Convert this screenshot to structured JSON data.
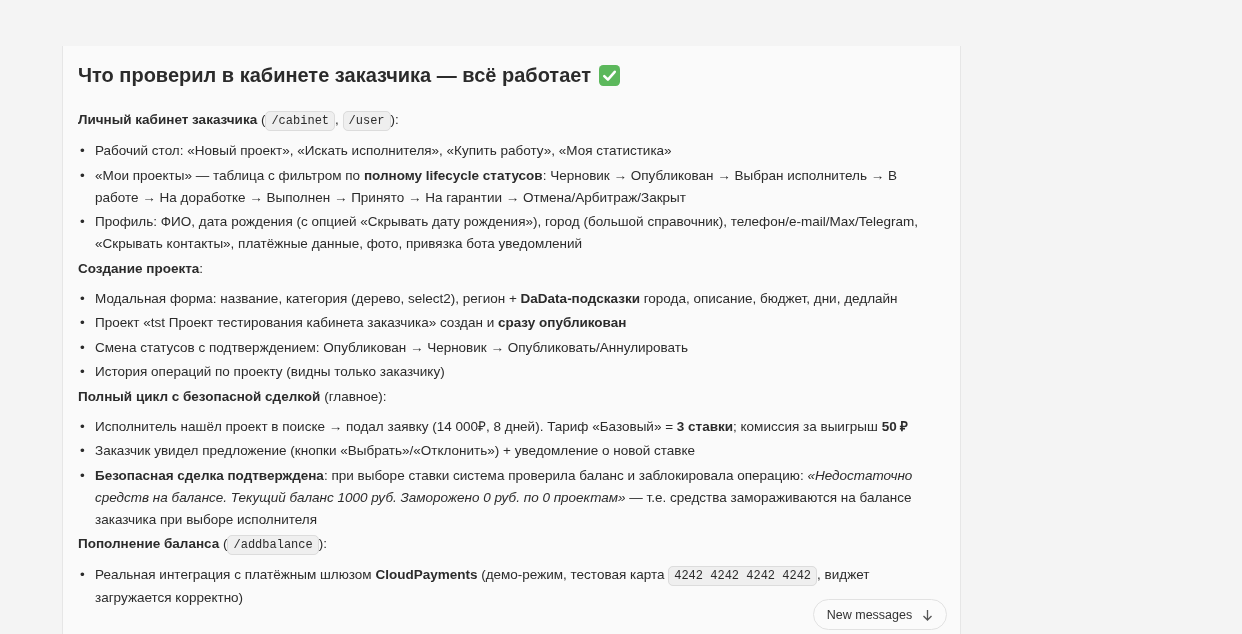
{
  "heading": {
    "text": "Что проверил в кабинете заказчика — всё работает"
  },
  "sections": [
    {
      "title": [
        {
          "kind": "text",
          "text": "**Личный кабинет заказчика** ("
        },
        {
          "kind": "code",
          "text": "/cabinet"
        },
        {
          "kind": "text",
          "text": ", "
        },
        {
          "kind": "code",
          "text": "/user"
        },
        {
          "kind": "text",
          "text": "):"
        }
      ],
      "items": [
        {
          "marker": "•",
          "segments": [
            {
              "kind": "text",
              "text": "Рабочий стол: «Новый проект», «Искать исполнителя», «Купить работу», «Моя статистика»"
            }
          ]
        },
        {
          "marker": "•",
          "segments": [
            {
              "kind": "text",
              "text": "«Мои проекты» — таблица с фильтром по **полному lifecycle статусов**: Черновик → Опубликован → Выбран исполнитель → В работе → На доработке → Выполнен → Принято → На гарантии → Отмена/Арбитраж/Закрыт"
            }
          ]
        },
        {
          "marker": "•",
          "segments": [
            {
              "kind": "text",
              "text": "Профиль: ФИО, дата рождения (с опцией «Скрывать дату рождения»), город (большой справочник), телефон/e-mail/Max/Telegram, «Скрывать контакты», платёжные данные, фото, привязка бота уведомлений"
            }
          ]
        }
      ]
    },
    {
      "title": [
        {
          "kind": "text",
          "text": "**Создание проекта**:"
        }
      ],
      "items": [
        {
          "marker": "•",
          "segments": [
            {
              "kind": "text",
              "text": "Модальная форма: название, категория (дерево, select2), регион + **DaData-подсказки** города, описание, бюджет, дни, дедлайн"
            }
          ]
        },
        {
          "marker": "•",
          "segments": [
            {
              "kind": "text",
              "text": "Проект «tst Проект тестирования кабинета заказчика» создан и **сразу опубликован**"
            }
          ]
        },
        {
          "marker": "•",
          "segments": [
            {
              "kind": "text",
              "text": "Смена статусов с подтверждением: Опубликован → Черновик → Опубликовать/Аннулировать"
            }
          ]
        },
        {
          "marker": "•",
          "segments": [
            {
              "kind": "text",
              "text": "История операций по проекту (видны только заказчику)"
            }
          ]
        }
      ]
    },
    {
      "title": [
        {
          "kind": "text",
          "text": "**Полный цикл с безопасной сделкой** (главное):"
        }
      ],
      "items": [
        {
          "marker": "•",
          "segments": [
            {
              "kind": "text",
              "text": "Исполнитель нашёл проект в поиске → подал заявку (14 000₽, 8 дней). Тариф «Базовый» = **3 ставки**; комиссия за выигрыш **50 ₽**"
            }
          ]
        },
        {
          "marker": "•",
          "segments": [
            {
              "kind": "text",
              "text": "Заказчик увидел предложение (кнопки «Выбрать»/«Отклонить») + уведомление о новой ставке"
            }
          ]
        },
        {
          "marker": "•",
          "segments": [
            {
              "kind": "text",
              "text": "**Безопасная сделка подтверждена**: при выборе ставки система проверила баланс и заблокировала операцию: *«Недостаточно средств на балансе. Текущий баланс 1000 руб. Заморожено 0 руб. по 0 проектам»* — т.е. средства замораживаются на балансе заказчика при выборе исполнителя"
            }
          ]
        }
      ]
    },
    {
      "title": [
        {
          "kind": "text",
          "text": "**Пополнение баланса** ("
        },
        {
          "kind": "code",
          "text": "/addbalance"
        },
        {
          "kind": "text",
          "text": "):"
        }
      ],
      "items": [
        {
          "marker": "•",
          "segments": [
            {
              "kind": "text",
              "text": "Реальная интеграция с платёжным шлюзом **CloudPayments** (демо-режим, тестовая карта "
            },
            {
              "kind": "code",
              "text": "4242 4242 4242 4242"
            },
            {
              "kind": "text",
              "text": ", виджет загружается корректно)"
            }
          ]
        }
      ]
    }
  ],
  "new_messages_button": {
    "label": "New messages"
  }
}
